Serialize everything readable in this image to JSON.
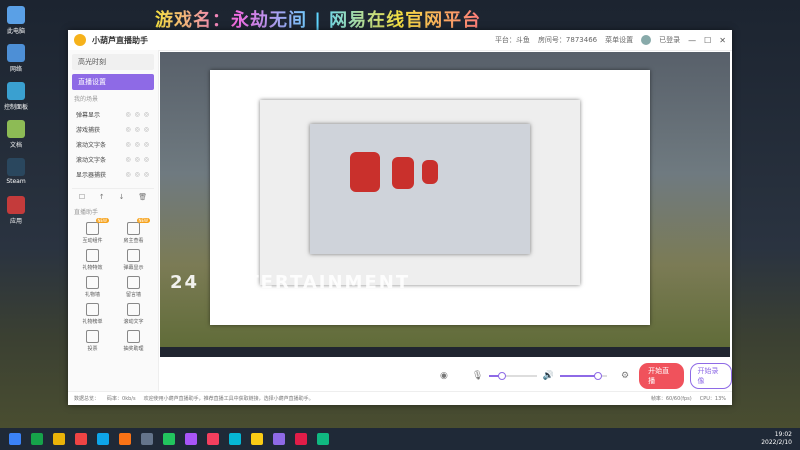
{
  "banner": "游戏名：永劫无间 | 网易在线官网平台",
  "desktop_icons": [
    {
      "label": "此电脑",
      "color": "#5aa0e6"
    },
    {
      "label": "网络",
      "color": "#4d8fd6"
    },
    {
      "label": "控制面板",
      "color": "#3aa0d0"
    },
    {
      "label": "文档",
      "color": "#8dbb55"
    },
    {
      "label": "Steam",
      "color": "#2a475e"
    },
    {
      "label": "应用",
      "color": "#c43b3b"
    }
  ],
  "window": {
    "title": "小葫芦直播助手",
    "platform": "平台：斗鱼",
    "room": "房间号：7873466",
    "menu": "菜单设置",
    "user": "已登录",
    "minimize": "—",
    "maximize": "☐",
    "close": "✕"
  },
  "sidebar": {
    "nav": [
      {
        "label": "高光时刻"
      },
      {
        "label": "直播设置"
      }
    ],
    "scene_title": "我的场景",
    "scenes": [
      {
        "label": "弹幕显示"
      },
      {
        "label": "游戏捕获"
      },
      {
        "label": "滚动文字条"
      },
      {
        "label": "滚动文字条"
      },
      {
        "label": "显示器捕获"
      }
    ],
    "scene_ctl": "◎ ◎ ◎",
    "tools": [
      "☐",
      "↑",
      "↓",
      "🗑"
    ],
    "widgets_title": "直播助手",
    "widgets": [
      {
        "label": "互动组件",
        "badge": "NEW"
      },
      {
        "label": "房主查看",
        "badge": "NEW"
      },
      {
        "label": "礼物特效",
        "badge": ""
      },
      {
        "label": "弹幕显示",
        "badge": ""
      },
      {
        "label": "礼物墙",
        "badge": ""
      },
      {
        "label": "留言墙",
        "badge": ""
      },
      {
        "label": "礼物榜单",
        "badge": ""
      },
      {
        "label": "滚动文字",
        "badge": ""
      },
      {
        "label": "投票",
        "badge": ""
      },
      {
        "label": "抽奖助理",
        "badge": ""
      }
    ]
  },
  "preview": {
    "ent_text": "ENTERTAINMENT",
    "num": "24"
  },
  "controls": {
    "start_live": "开始直播",
    "start_record": "开始录像",
    "chat_icon": "◉",
    "mic_icon": "🎙",
    "speaker_icon": "🔊",
    "gear_icon": "⚙"
  },
  "status": {
    "left": "数据总览：",
    "bitrate": "码率：0kb/s",
    "notice": "欢迎使用小葫芦直播助手，推荐直播工具中获取链接，选择小葫芦直播助手。",
    "fps": "帧率：60/60(fps)",
    "cpu": "CPU：13%"
  },
  "clock": {
    "time": "19:02",
    "date": "2022/2/10"
  },
  "taskbar_colors": [
    "#3b82f6",
    "#16a34a",
    "#eab308",
    "#ef4444",
    "#0ea5e9",
    "#f97316",
    "#64748b",
    "#22c55e",
    "#a855f7",
    "#f43f5e",
    "#06b6d4",
    "#facc15",
    "#8e6ae6",
    "#e11d48",
    "#10b981"
  ]
}
